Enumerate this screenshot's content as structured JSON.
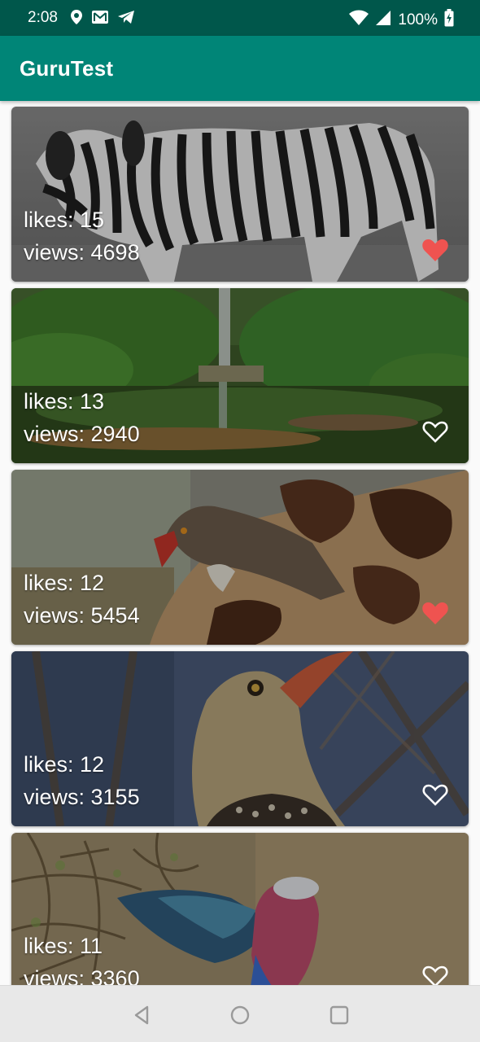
{
  "status_bar": {
    "time": "2:08",
    "battery_text": "100%",
    "left_icons": [
      "location-pin-icon",
      "gmail-icon",
      "telegram-icon"
    ],
    "right_icons": [
      "wifi-icon",
      "signal-icon",
      "battery-charging-icon"
    ]
  },
  "app_bar": {
    "title": "GuruTest",
    "color": "#008577",
    "status_color": "#00574b"
  },
  "cards": [
    {
      "likes": "likes: 15",
      "views": "views: 4698",
      "liked": true,
      "image": "zebra-photo"
    },
    {
      "likes": "likes: 13",
      "views": "views: 2940",
      "liked": false,
      "image": "waterfall-photo"
    },
    {
      "likes": "likes: 12",
      "views": "views: 5454",
      "liked": true,
      "image": "oxpecker-giraffe-photo"
    },
    {
      "likes": "likes: 12",
      "views": "views: 3155",
      "liked": false,
      "image": "hornbill-photo"
    },
    {
      "likes": "likes: 11",
      "views": "views: 3360",
      "liked": false,
      "image": "roller-bird-photo"
    }
  ],
  "heart_color": "#ef5350",
  "nav_bar": {
    "buttons": [
      "back-icon",
      "home-icon",
      "recents-icon"
    ]
  }
}
